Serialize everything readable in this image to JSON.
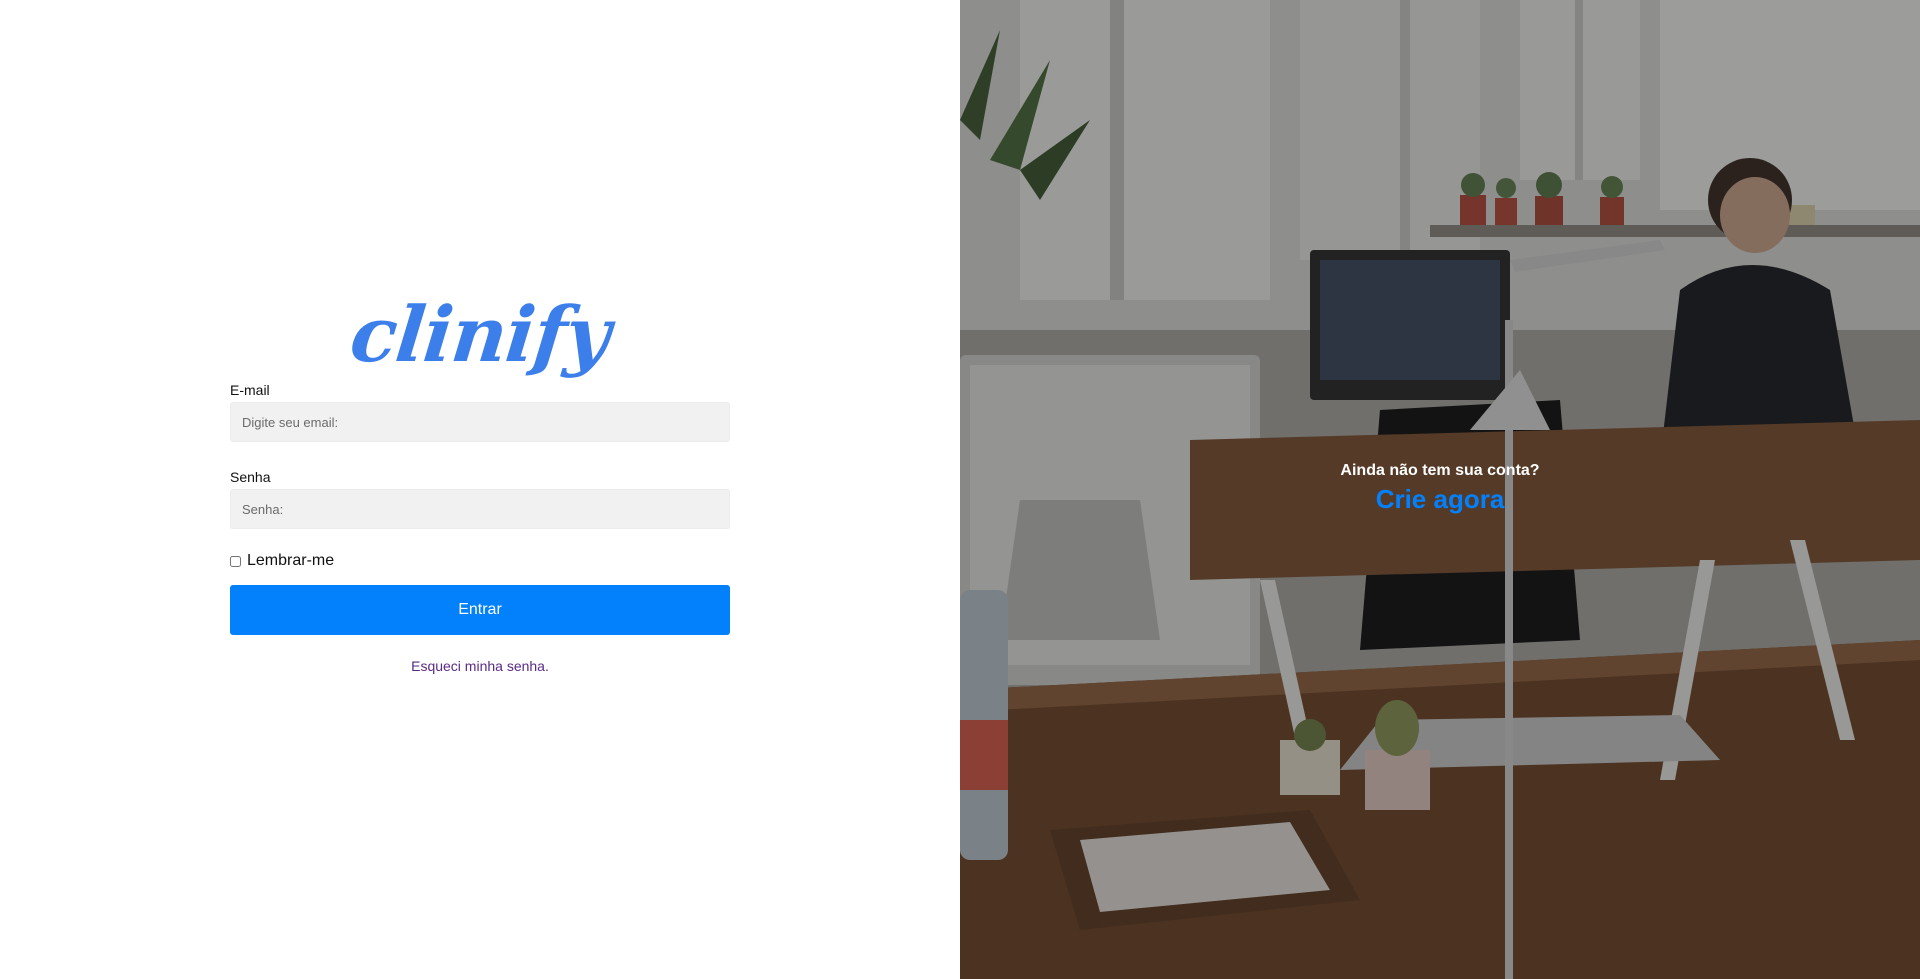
{
  "brand": {
    "logo_text": "clinify",
    "accent_color": "#0380fc",
    "logo_color": "#3d7fea"
  },
  "login": {
    "email_label": "E-mail",
    "email_placeholder": "Digite seu email:",
    "email_value": "",
    "password_label": "Senha",
    "password_placeholder": "Senha:",
    "password_value": "",
    "remember_label": "Lembrar-me",
    "remember_checked": false,
    "submit_label": "Entrar",
    "forgot_label": "Esqueci minha senha."
  },
  "signup": {
    "question": "Ainda não tem sua conta?",
    "link_label": "Crie agora"
  },
  "background": {
    "icon": "office-photo"
  }
}
